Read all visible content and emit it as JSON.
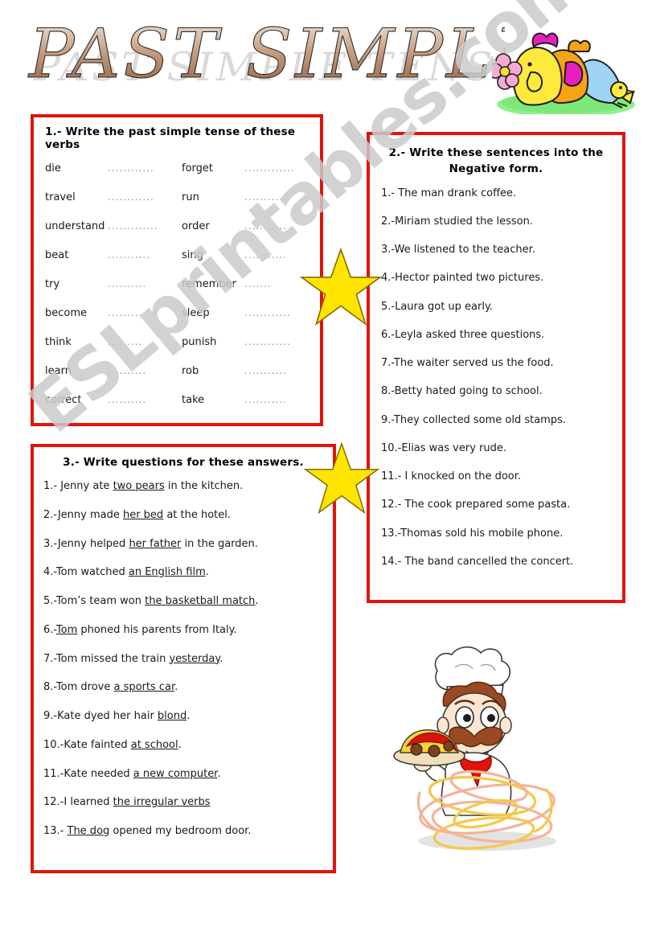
{
  "worksheet": {
    "title": "PAST SIMPLE TENSE",
    "watermark": "ESLprintables.com",
    "border_color": "#e2140a",
    "star_color": "#ffe500",
    "title_fill_color": "#a8estimate"
  },
  "exercise1": {
    "heading": "1.- Write the past simple tense of these verbs",
    "blank": "..............",
    "rows": [
      {
        "left": "die",
        "left_blank": "............",
        "right": "forget",
        "right_blank": "............."
      },
      {
        "left": "travel",
        "left_blank": "............",
        "right": "run",
        "right_blank": "............"
      },
      {
        "left": "understand",
        "left_blank": ".............",
        "right": "order",
        "right_blank": "..........."
      },
      {
        "left": "beat",
        "left_blank": "...........",
        "right": "sing",
        "right_blank": "..........."
      },
      {
        "left": "try",
        "left_blank": "..........",
        "right": "remember",
        "right_blank": "......."
      },
      {
        "left": "become",
        "left_blank": ".........",
        "right": "sleep",
        "right_blank": "............"
      },
      {
        "left": "think",
        "left_blank": ".........",
        "right": "punish",
        "right_blank": "............"
      },
      {
        "left": "learn",
        "left_blank": "..........",
        "right": "rob",
        "right_blank": "..........."
      },
      {
        "left": "correct",
        "left_blank": "..........",
        "right": "take",
        "right_blank": "..........."
      }
    ]
  },
  "exercise2": {
    "heading": "2.- Write these sentences into the Negative form.",
    "items": [
      "1.- The man drank coffee.",
      "2.-Miriam studied the lesson.",
      "3.-We listened to the teacher.",
      "4.-Hector painted two pictures.",
      "5.-Laura got up early.",
      "6.-Leyla asked three questions.",
      "7.-The waiter served us the food.",
      "8.-Betty hated going to school.",
      "9.-They collected some old stamps.",
      "10.-Elias was very rude.",
      "11.- I knocked on the door.",
      "12.- The cook prepared some pasta.",
      "13.-Thomas sold his mobile phone.",
      "14.- The band cancelled the concert."
    ]
  },
  "exercise3": {
    "heading": "3.- Write questions for these answers.",
    "items": [
      {
        "before": "1.- Jenny ate ",
        "underlined": "two pears",
        "after": " in the kitchen."
      },
      {
        "before": "2.-Jenny made ",
        "underlined": "her bed",
        "after": " at the hotel."
      },
      {
        "before": "3.-Jenny  helped ",
        "underlined": "her father",
        "after": " in the garden."
      },
      {
        "before": "4.-Tom watched ",
        "underlined": "an English film",
        "after": "."
      },
      {
        "before": "5.-Tom’s team won ",
        "underlined": "the basketball match",
        "after": "."
      },
      {
        "before": "6.-",
        "underlined": "Tom",
        "after": " phoned his parents from Italy."
      },
      {
        "before": "7.-Tom missed the train ",
        "underlined": "yesterday",
        "after": "."
      },
      {
        "before": "8.-Tom drove ",
        "underlined": "a sports car",
        "after": "."
      },
      {
        "before": "9.-Kate dyed her hair ",
        "underlined": "blond",
        "after": "."
      },
      {
        "before": "10.-Kate fainted ",
        "underlined": "at school",
        "after": "."
      },
      {
        "before": "11.-Kate needed ",
        "underlined": "a new computer",
        "after": "."
      },
      {
        "before": "12.-I learned ",
        "underlined": "the irregular verbs",
        "after": ""
      },
      {
        "before": "13.- ",
        "underlined": "The dog",
        "after": " opened my bedroom door."
      }
    ]
  },
  "illustrations": {
    "chicks": "chicks-with-flower-clipart",
    "chef": "chef-with-spaghetti-clipart",
    "star1": "yellow-star",
    "star2": "yellow-star"
  }
}
